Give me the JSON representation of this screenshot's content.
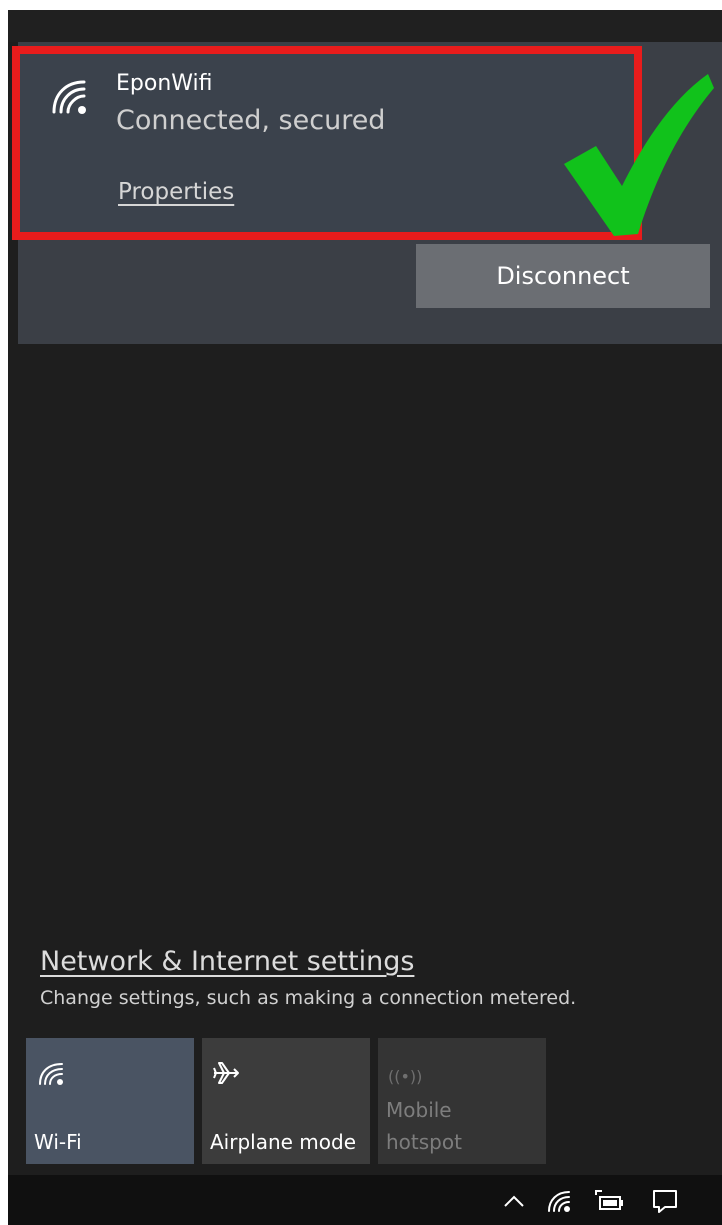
{
  "network": {
    "name": "EponWifi",
    "status": "Connected, secured",
    "properties_link": "Properties",
    "disconnect_label": "Disconnect"
  },
  "settings": {
    "title": "Network & Internet settings",
    "subtitle": "Change settings, such as making a connection metered."
  },
  "quick_actions": [
    {
      "label": "Wi-Fi",
      "icon": "wifi-icon",
      "state": "on"
    },
    {
      "label": "Airplane mode",
      "icon": "airplane-icon",
      "state": "off"
    },
    {
      "label_line1": "Mobile",
      "label_line2": "hotspot",
      "icon": "hotspot-icon",
      "state": "disabled"
    }
  ],
  "taskbar": {
    "icons": [
      "chevron-up-icon",
      "wifi-icon",
      "battery-icon",
      "notification-icon"
    ]
  },
  "colors": {
    "highlight_border": "#e81c1c",
    "checkmark": "#11c21b",
    "panel_bg": "#3b3f46",
    "flyout_bg": "#1e1e1e",
    "tile_active": "#4a5463"
  }
}
